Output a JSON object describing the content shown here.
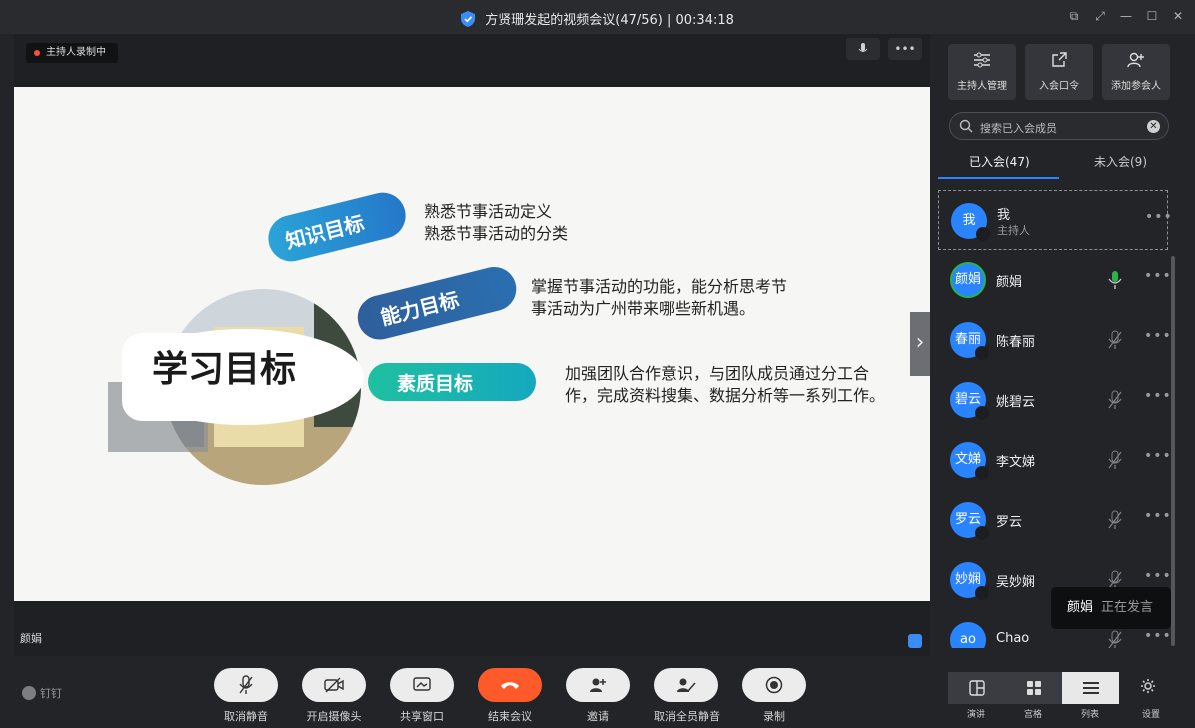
{
  "window": {
    "title": "方贤珊发起的视频会议(47/56) | 00:34:18"
  },
  "stage": {
    "recording_badge": "主持人录制中",
    "speaker_name": "颜娟",
    "slide": {
      "main_title": "学习目标",
      "pills": [
        "知识目标",
        "能力目标",
        "素质目标"
      ],
      "texts": [
        [
          "熟悉节事活动定义",
          "熟悉节事活动的分类"
        ],
        [
          "掌握节事活动的功能，能分析思考节",
          "事活动为广州带来哪些新机遇。"
        ],
        [
          "加强团队合作意识，与团队成员通过分工合",
          "作，完成资料搜集、数据分析等一系列工作。"
        ]
      ]
    }
  },
  "sidebar": {
    "tools": [
      {
        "label": "主持人管理",
        "icon": "sliders-icon"
      },
      {
        "label": "入会口令",
        "icon": "share-icon"
      },
      {
        "label": "添加参会人",
        "icon": "add-user-icon"
      }
    ],
    "search": {
      "placeholder": "搜索已入会成员"
    },
    "tabs": {
      "joined": "已入会(47)",
      "not_joined": "未入会(9)"
    },
    "members": [
      {
        "avatar": "我",
        "name": "我",
        "role": "主持人"
      },
      {
        "avatar": "颜娟",
        "name": "颜娟",
        "mic": "on"
      },
      {
        "avatar": "春丽",
        "name": "陈春丽",
        "mic": "muted"
      },
      {
        "avatar": "碧云",
        "name": "姚碧云",
        "mic": "muted"
      },
      {
        "avatar": "文娣",
        "name": "李文娣",
        "mic": "muted"
      },
      {
        "avatar": "罗云",
        "name": "罗云",
        "mic": "muted"
      },
      {
        "avatar": "妙娴",
        "name": "吴妙娴",
        "mic": "muted"
      },
      {
        "avatar": "ao",
        "name": "Chao",
        "mic": "muted"
      }
    ],
    "speaking": {
      "name": "颜娟",
      "status": "正在发言"
    }
  },
  "bottombar": {
    "brand": "钉钉",
    "controls": [
      "取消静音",
      "开启摄像头",
      "共享窗口",
      "结束会议",
      "邀请",
      "取消全员静音",
      "录制"
    ],
    "views": [
      "演讲",
      "宫格",
      "列表"
    ],
    "settings_label": "设置"
  },
  "colors": {
    "accent": "#2b84ff",
    "end": "#ff5a2a",
    "pill_teal": "#18b6a8",
    "pill_navy": "#2c6aa6"
  }
}
